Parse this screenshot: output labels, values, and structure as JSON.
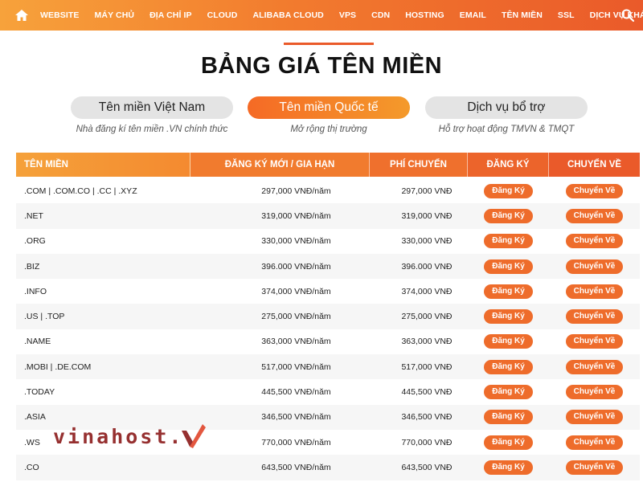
{
  "nav": {
    "items": [
      "WEBSITE",
      "MÁY CHỦ",
      "ĐỊA CHỈ IP",
      "CLOUD",
      "ALIBABA CLOUD",
      "VPS",
      "CDN",
      "HOSTING",
      "EMAIL",
      "TÊN MIỀN",
      "SSL",
      "DỊCH VỤ KHÁC"
    ],
    "home_icon": "home-icon",
    "search_icon": "search-icon"
  },
  "title": "BẢNG GIÁ TÊN MIỀN",
  "tabs": [
    {
      "label": "Tên miền Việt Nam",
      "sub": "Nhà đăng kí tên miền .VN chính thức",
      "active": false
    },
    {
      "label": "Tên miền Quốc tế",
      "sub": "Mở rộng thị trường",
      "active": true
    },
    {
      "label": "Dịch vụ bổ trợ",
      "sub": "Hỗ trợ hoạt động TMVN & TMQT",
      "active": false
    }
  ],
  "table": {
    "headers": [
      "TÊN MIỀN",
      "ĐĂNG KÝ MỚI / GIA HẠN",
      "PHÍ CHUYỂN",
      "ĐĂNG KÝ",
      "CHUYỂN VỀ"
    ],
    "register_label": "Đăng Ký",
    "transfer_label": "Chuyển Về",
    "rows": [
      {
        "name": ".COM | .COM.CO | .CC | .XYZ",
        "price": "297,000 VNĐ/năm",
        "transfer": "297,000 VNĐ"
      },
      {
        "name": ".NET",
        "price": "319,000 VNĐ/năm",
        "transfer": "319,000 VNĐ"
      },
      {
        "name": ".ORG",
        "price": "330,000 VNĐ/năm",
        "transfer": "330,000 VNĐ"
      },
      {
        "name": ".BIZ",
        "price": "396.000 VNĐ/năm",
        "transfer": "396.000 VNĐ"
      },
      {
        "name": ".INFO",
        "price": "374,000 VNĐ/năm",
        "transfer": "374,000 VNĐ"
      },
      {
        "name": ".US | .TOP",
        "price": "275,000 VNĐ/năm",
        "transfer": "275,000 VNĐ"
      },
      {
        "name": ".NAME",
        "price": "363,000 VNĐ/năm",
        "transfer": "363,000 VNĐ"
      },
      {
        "name": ".MOBI | .DE.COM",
        "price": "517,000 VNĐ/năm",
        "transfer": "517,000 VNĐ"
      },
      {
        "name": ".TODAY",
        "price": "445,500 VNĐ/năm",
        "transfer": "445,500 VNĐ"
      },
      {
        "name": ".ASIA",
        "price": "346,500 VNĐ/năm",
        "transfer": "346,500 VNĐ"
      },
      {
        "name": ".WS",
        "price": "770,000 VNĐ/năm",
        "transfer": "770,000 VNĐ"
      },
      {
        "name": ".CO",
        "price": "643,500 VNĐ/năm",
        "transfer": "643,500 VNĐ"
      }
    ]
  },
  "watermark": "vinahost."
}
